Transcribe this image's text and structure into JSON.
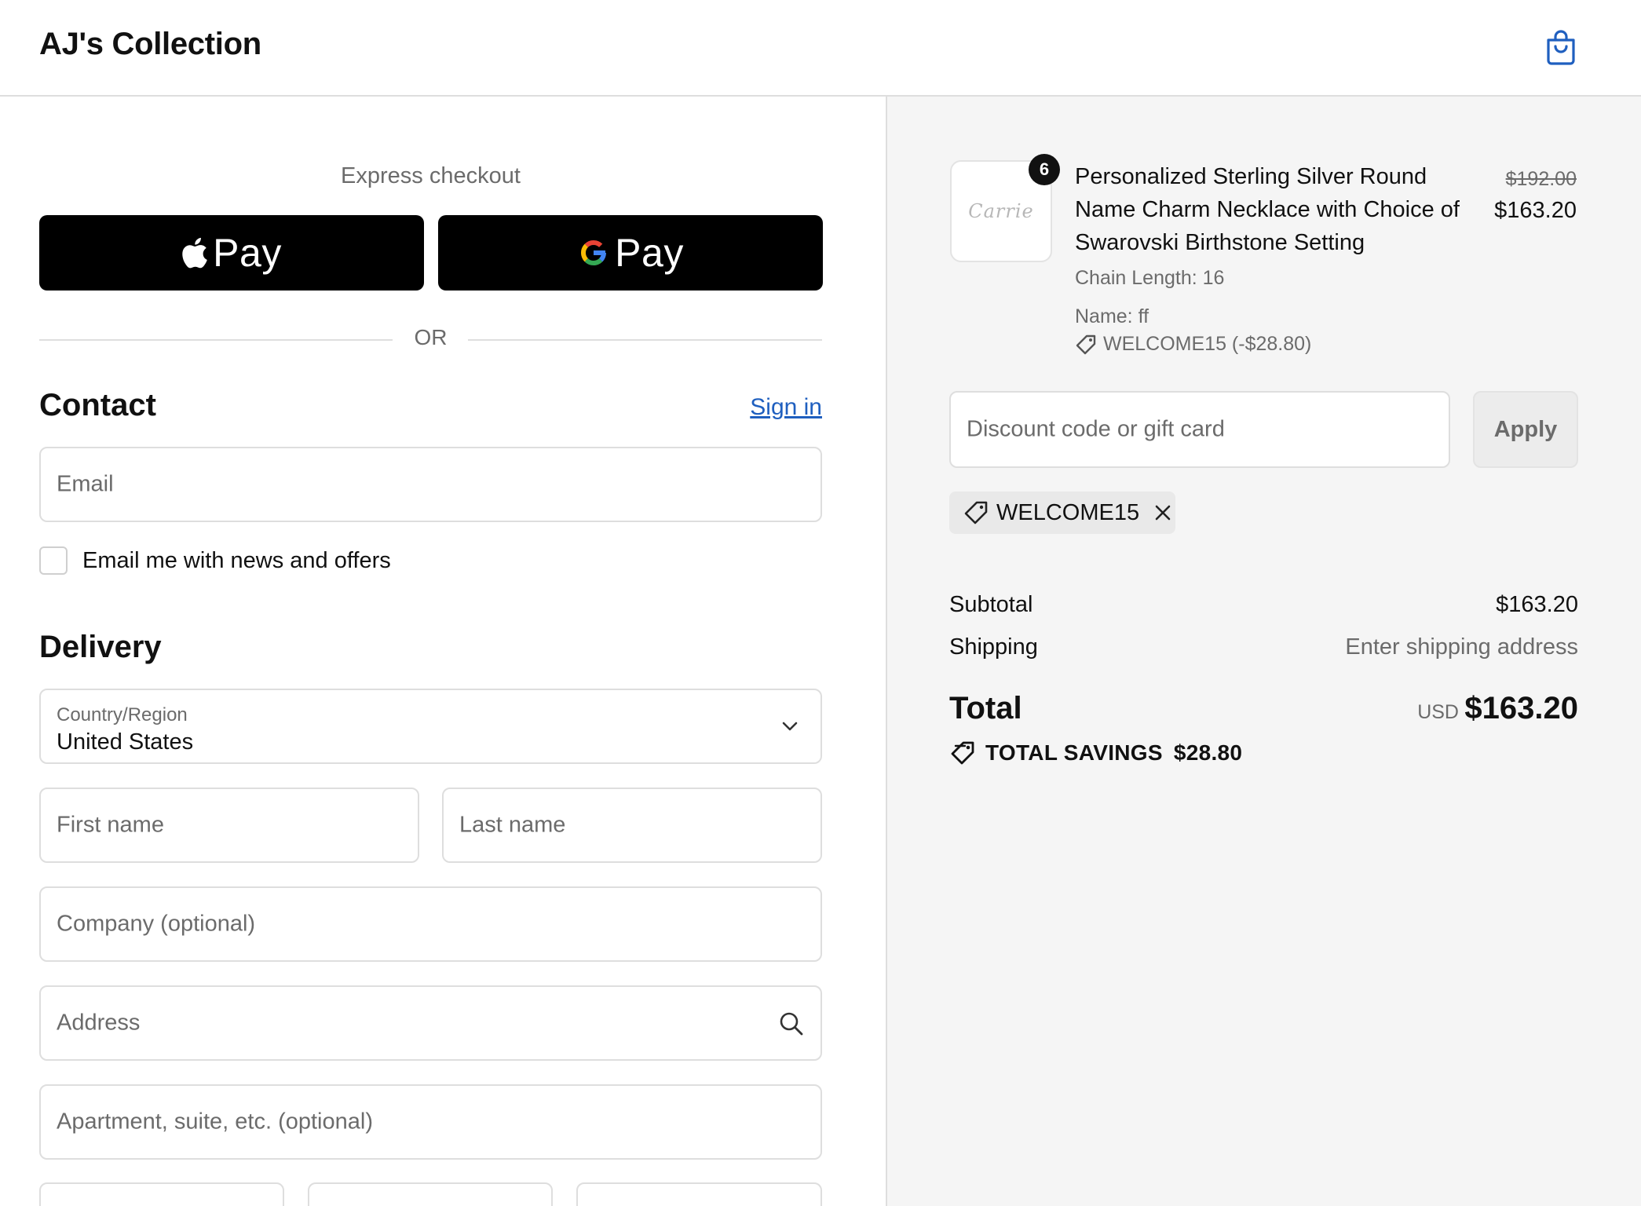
{
  "header": {
    "store_name": "AJ's Collection",
    "cart_icon": "shopping-bag-icon"
  },
  "express": {
    "title": "Express checkout",
    "apple_pay_label": "Pay",
    "google_pay_label": "Pay",
    "separator": "OR"
  },
  "contact": {
    "title": "Contact",
    "sign_in": "Sign in",
    "email_placeholder": "Email",
    "newsletter_label": "Email me with news and offers",
    "newsletter_checked": false
  },
  "delivery": {
    "title": "Delivery",
    "country_label": "Country/Region",
    "country_value": "United States",
    "first_name_placeholder": "First name",
    "last_name_placeholder": "Last name",
    "company_placeholder": "Company (optional)",
    "address_placeholder": "Address",
    "apartment_placeholder": "Apartment, suite, etc. (optional)"
  },
  "summary": {
    "item": {
      "quantity": "6",
      "name": "Personalized Sterling Silver Round Name Charm Necklace with Choice of Swarovski Birthstone Setting",
      "thumbnail_text": "Carrie",
      "chain_length": "Chain Length: 16",
      "custom_name": "Name: ff",
      "discount": "WELCOME15 (-$28.80)",
      "original_price": "$192.00",
      "price": "$163.20"
    },
    "discount_placeholder": "Discount code or gift card",
    "apply_label": "Apply",
    "applied_code": "WELCOME15",
    "subtotal_label": "Subtotal",
    "subtotal_value": "$163.20",
    "shipping_label": "Shipping",
    "shipping_value": "Enter shipping address",
    "total_label": "Total",
    "currency": "USD",
    "total_value": "$163.20",
    "savings_label": "TOTAL SAVINGS",
    "savings_value": "$28.80"
  },
  "colors": {
    "link": "#1f5fbf",
    "summary_bg": "#f5f5f5",
    "border": "#dedede",
    "button_dark": "#000000"
  }
}
